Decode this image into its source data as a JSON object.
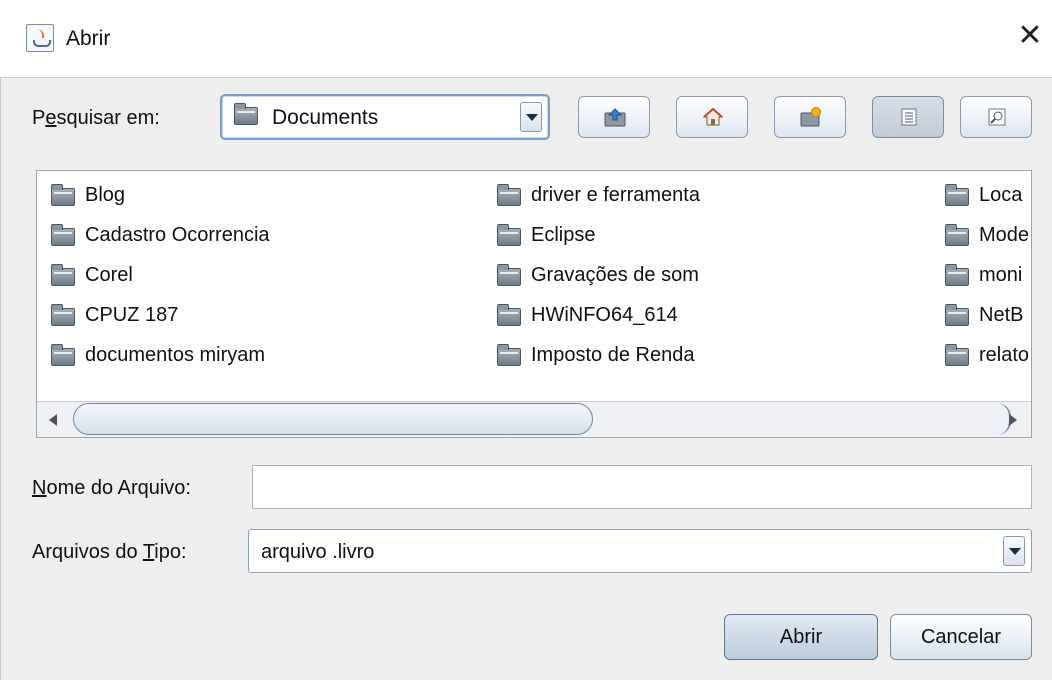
{
  "window": {
    "title": "Abrir"
  },
  "toolbar": {
    "look_in_label_prefix": "P",
    "look_in_label_mnemonic": "e",
    "look_in_label_rest": "squisar em:",
    "look_in_value": "Documents",
    "buttons": [
      {
        "name": "up-folder",
        "icon": "up-folder-icon"
      },
      {
        "name": "home",
        "icon": "home-icon"
      },
      {
        "name": "new-folder",
        "icon": "new-folder-icon"
      },
      {
        "name": "list-view",
        "icon": "list-view-icon",
        "pressed": true
      },
      {
        "name": "details-view",
        "icon": "details-view-icon"
      }
    ]
  },
  "files": {
    "columns": [
      [
        "Blog",
        "Cadastro Ocorrencia",
        "Corel",
        "CPUZ 187",
        "documentos miryam"
      ],
      [
        "driver e ferramenta",
        "Eclipse",
        "Gravações de som",
        "HWiNFO64_614",
        "Imposto de Renda"
      ],
      [
        "Loca",
        "Mode",
        "moni",
        "NetB",
        "relato"
      ]
    ]
  },
  "form": {
    "filename_label_mnemonic": "N",
    "filename_label_rest": "ome do Arquivo:",
    "filename_value": "",
    "filetype_label_prefix": "Arquivos do ",
    "filetype_label_mnemonic": "T",
    "filetype_label_rest": "ipo:",
    "filetype_value": "arquivo .livro"
  },
  "actions": {
    "open_label": "Abrir",
    "cancel_label": "Cancelar"
  },
  "colors": {
    "accent": "#7f9ec4",
    "background": "#eeeeee"
  }
}
